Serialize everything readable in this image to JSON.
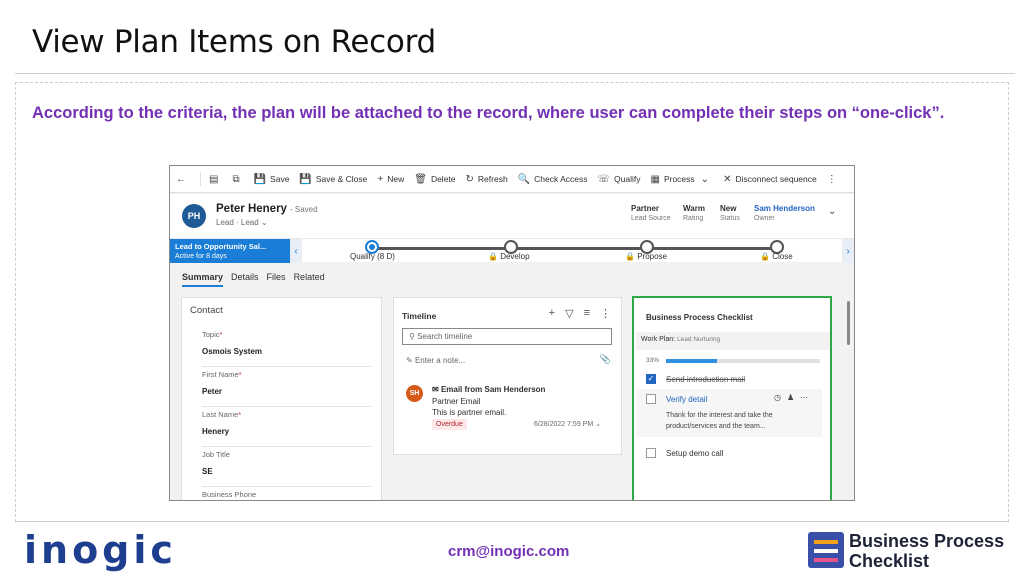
{
  "slide": {
    "title": "View Plan Items on Record",
    "intro": "According to the criteria, the plan will be attached to the record, where user can complete their steps on “one-click”.",
    "email": "crm@inogic.com",
    "logo_text": "inogic",
    "bpc_logo_line1": "Business Process",
    "bpc_logo_line2": "Checklist"
  },
  "toolbar": {
    "back_icon": "back-arrow-icon",
    "items": [
      {
        "icon": "save-icon",
        "label": "Save"
      },
      {
        "icon": "save-close-icon",
        "label": "Save & Close"
      },
      {
        "icon": "plus-icon",
        "label": "New"
      },
      {
        "icon": "trash-icon",
        "label": "Delete"
      },
      {
        "icon": "refresh-icon",
        "label": "Refresh"
      },
      {
        "icon": "check-access-icon",
        "label": "Check Access"
      },
      {
        "icon": "qualify-icon",
        "label": "Qualify"
      },
      {
        "icon": "process-icon",
        "label": "Process"
      },
      {
        "icon": "close-icon",
        "label": "Disconnect sequence"
      }
    ]
  },
  "record": {
    "initials": "PH",
    "name": "Peter Henery",
    "saved": "- Saved",
    "type": "Lead · Lead",
    "fields": [
      {
        "value": "Partner",
        "label": "Lead Source"
      },
      {
        "value": "Warm",
        "label": "Rating"
      },
      {
        "value": "New",
        "label": "Status"
      },
      {
        "value": "Sam Henderson",
        "label": "Owner"
      }
    ]
  },
  "bpf": {
    "stage_title": "Lead to Opportunity Sal...",
    "stage_sub": "Active for 8 days",
    "stages": [
      "Qualify  (8 D)",
      "Develop",
      "Propose",
      "Close"
    ]
  },
  "tabs": [
    "Summary",
    "Details",
    "Files",
    "Related"
  ],
  "contact": {
    "heading": "Contact",
    "fields": [
      {
        "label": "Topic",
        "required": true,
        "value": "Osmois System"
      },
      {
        "label": "First Name",
        "required": true,
        "value": "Peter"
      },
      {
        "label": "Last Name",
        "required": true,
        "value": "Henery"
      },
      {
        "label": "Job Title",
        "required": false,
        "value": "SE"
      },
      {
        "label": "Business Phone",
        "required": false,
        "value": ""
      }
    ]
  },
  "timeline": {
    "title": "Timeline",
    "search_placeholder": "Search timeline",
    "note_placeholder": "Enter a note...",
    "activity": {
      "initials": "SH",
      "title": "Email from Sam Henderson",
      "line1": "Partner Email",
      "line2": "This is partner email.",
      "badge": "Overdue",
      "date": "6/28/2022 7:59 PM"
    }
  },
  "checklist": {
    "title": "Business Process Checklist",
    "plan_label": "Work Plan:",
    "plan_name": "Lead Nurturing",
    "progress_text": "33%",
    "progress": 33,
    "steps": [
      {
        "label": "Send introduction mail",
        "done": true
      },
      {
        "label": "Verify detail",
        "done": false,
        "description": "Thank for the interest and take the product/services and the team..."
      },
      {
        "label": "Setup demo call",
        "done": false
      }
    ]
  }
}
